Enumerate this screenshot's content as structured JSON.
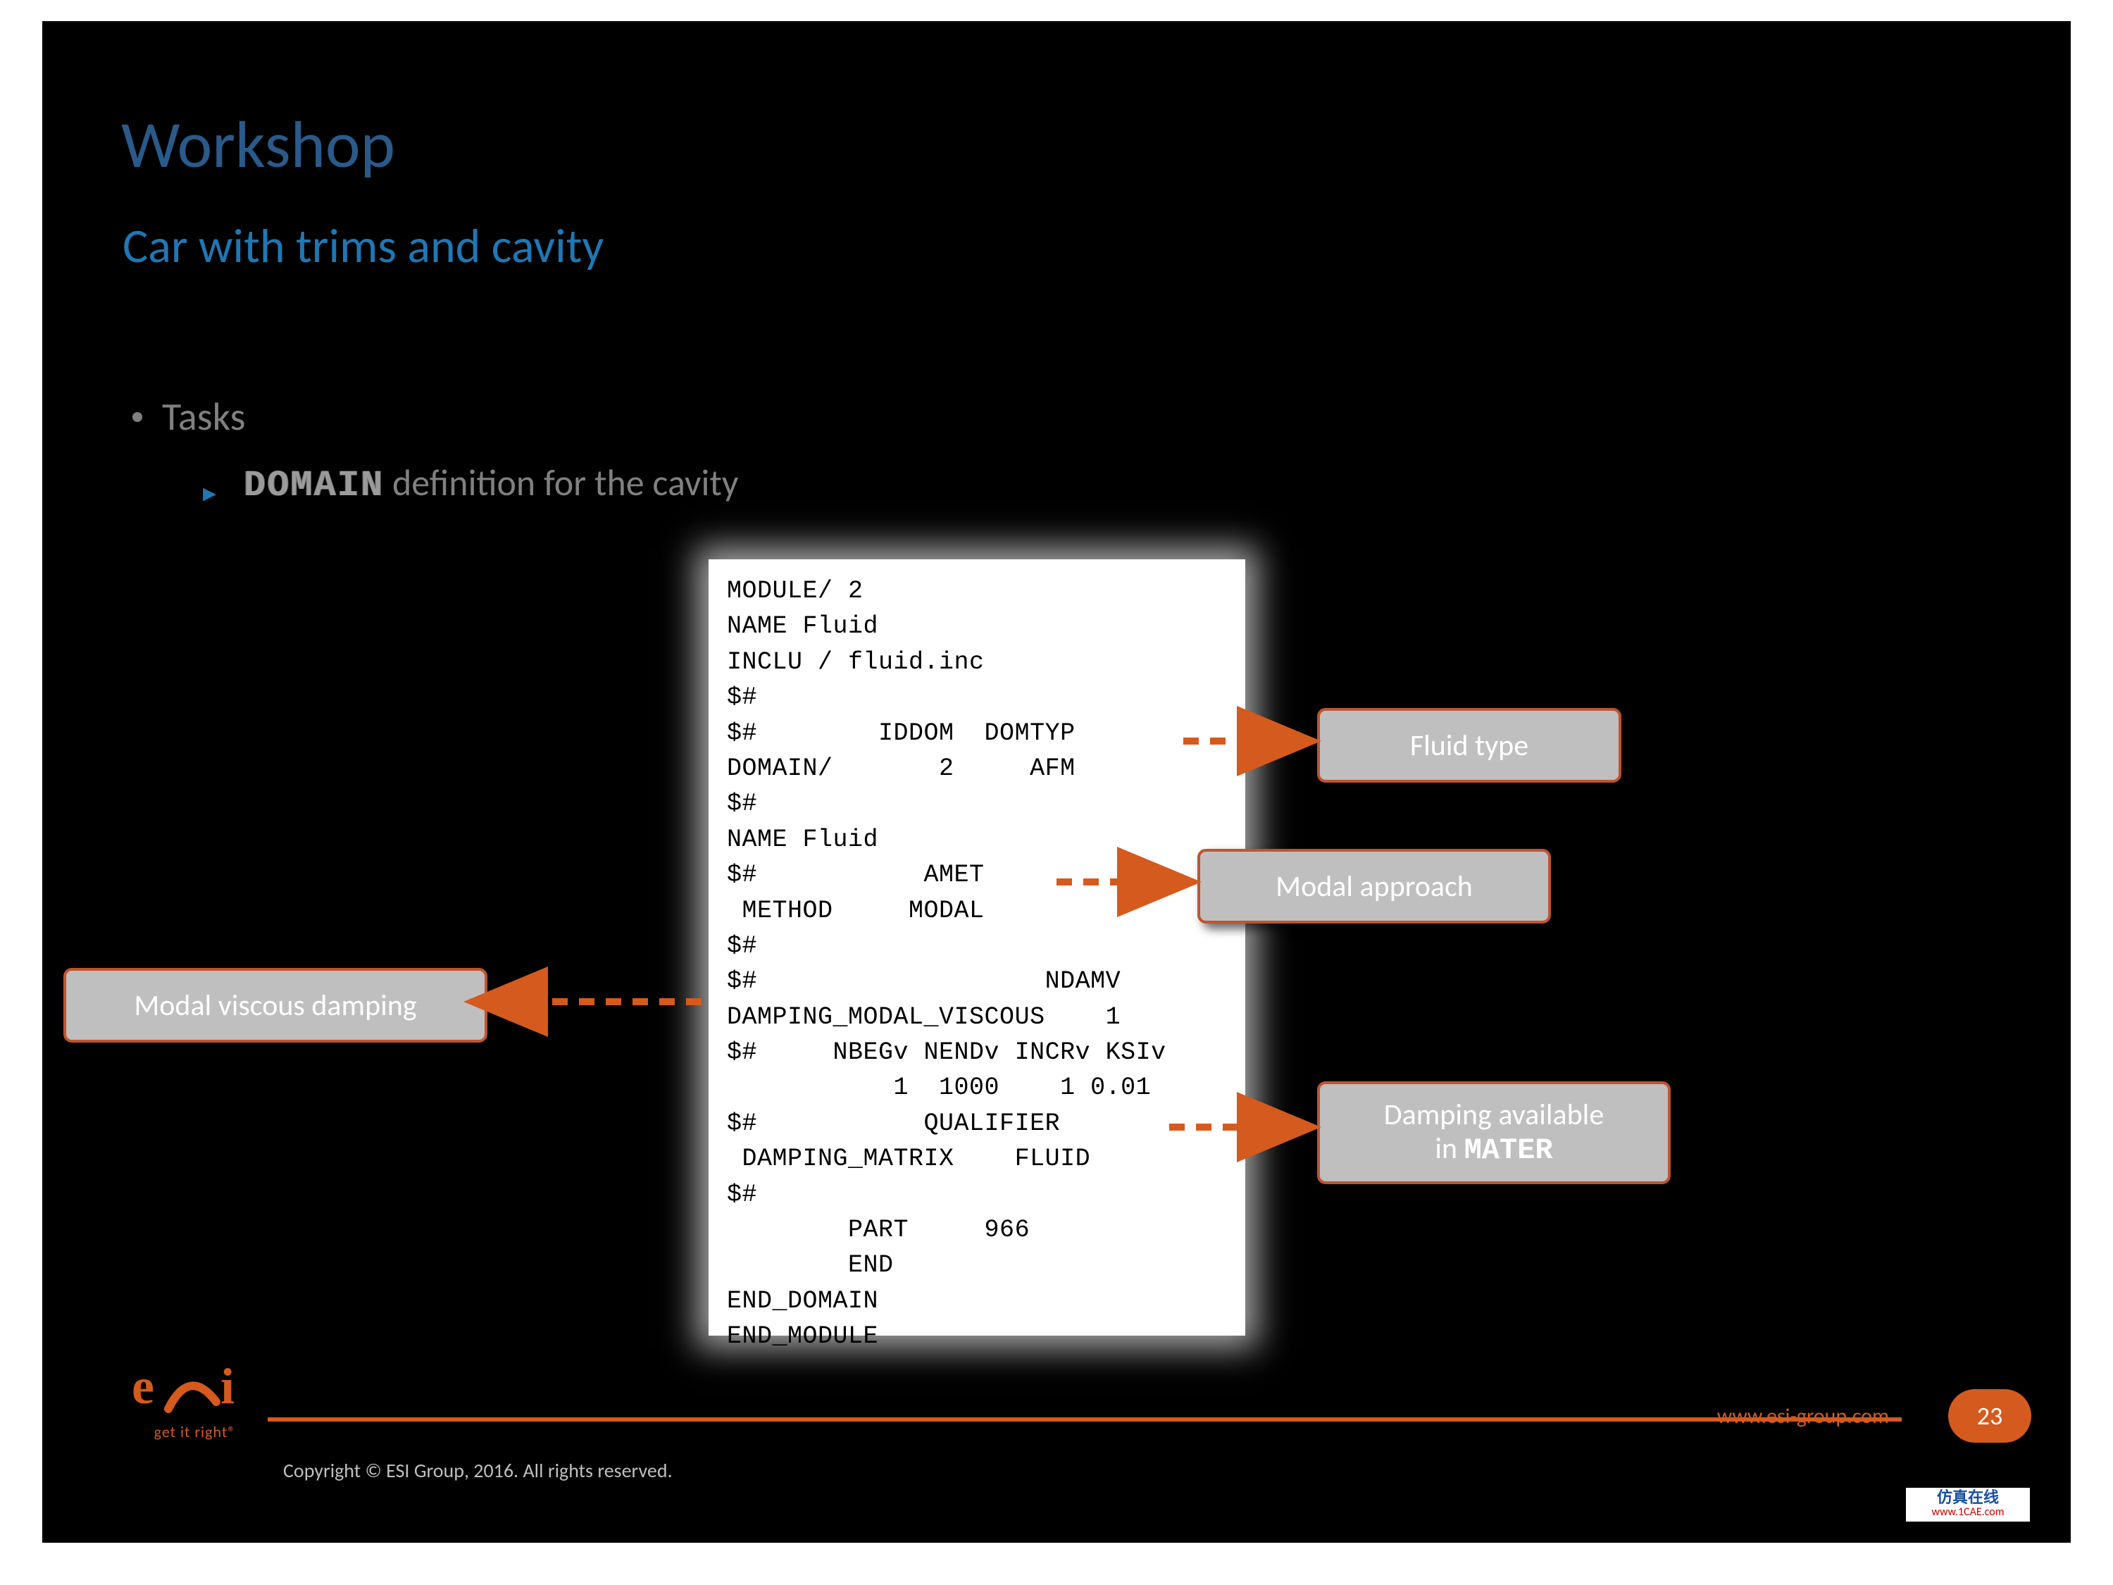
{
  "title": "Workshop",
  "subtitle": "Car with trims and cavity",
  "bullet1": "Tasks",
  "bullet2_domain": "DOMAIN",
  "bullet2_rest": "  definition for the cavity",
  "code": "MODULE/ 2\nNAME Fluid\nINCLU / fluid.inc\n$#\n$#        IDDOM  DOMTYP\nDOMAIN/       2     AFM\n$#\nNAME Fluid\n$#           AMET\n METHOD     MODAL\n$#\n$#                   NDAMV\nDAMPING_MODAL_VISCOUS    1\n$#     NBEGv NENDv INCRv KSIv\n           1  1000    1 0.01\n$#           QUALIFIER\n DAMPING_MATRIX    FLUID\n$#\n        PART     966\n        END\nEND_DOMAIN\nEND_MODULE",
  "callouts": {
    "fluid": "Fluid type",
    "modal": "Modal approach",
    "mvd": "Modal viscous damping",
    "damp_line1": "Damping available",
    "damp_line2_prefix": "in ",
    "damp_line2_bold": "MATER"
  },
  "footer": {
    "url": "www.esi-group.com",
    "page": "23",
    "copyright": "Copyright © ESI Group, 2016. All rights reserved.",
    "logo_text": "e∠i",
    "logo_tag": "get it right®"
  },
  "watermark": {
    "cn": "仿真在线",
    "url": "www.1CAE.com"
  }
}
